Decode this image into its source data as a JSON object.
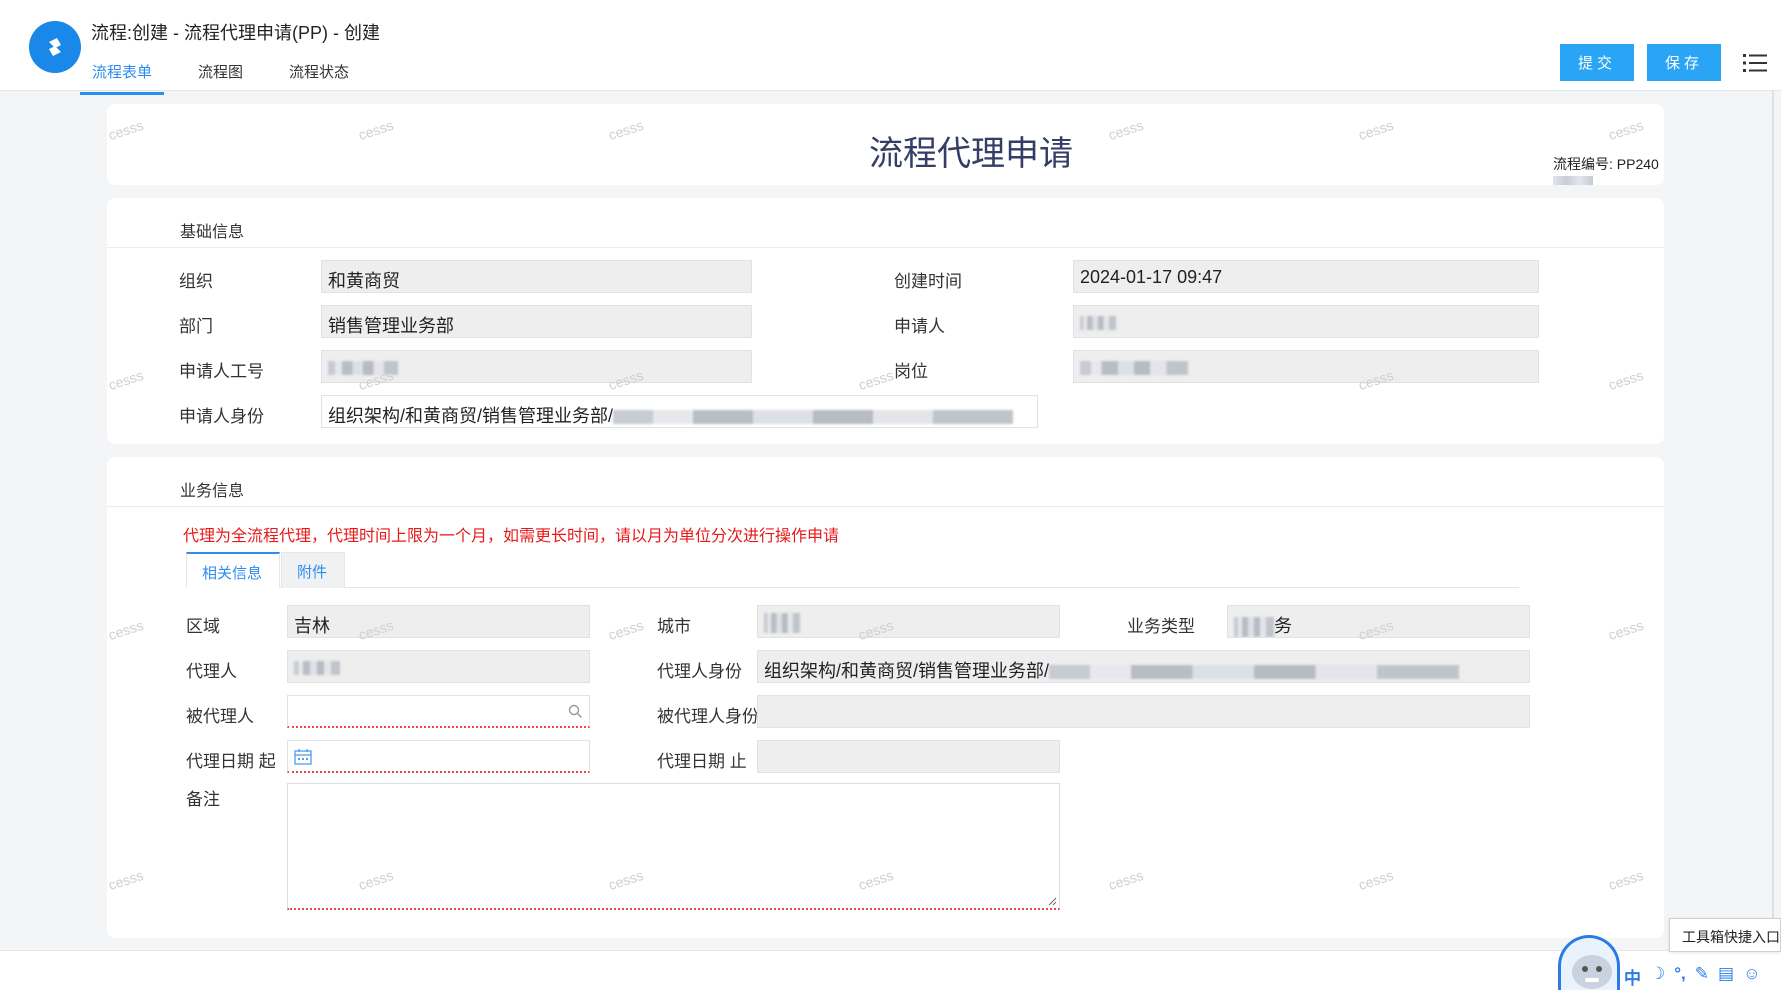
{
  "header": {
    "title": "流程:创建 - 流程代理申请(PP) - 创建",
    "tabs": [
      "流程表单",
      "流程图",
      "流程状态"
    ],
    "submit_label": "提交",
    "save_label": "保存"
  },
  "form": {
    "title": "流程代理申请",
    "flow_no_label": "流程编号:",
    "flow_no_value": "PP240"
  },
  "basic": {
    "section_title": "基础信息",
    "org_label": "组织",
    "org_value": "和黄商贸",
    "created_label": "创建时间",
    "created_value": "2024-01-17 09:47",
    "dept_label": "部门",
    "dept_value": "销售管理业务部",
    "applicant_label": "申请人",
    "emp_no_label": "申请人工号",
    "post_label": "岗位",
    "identity_label": "申请人身份",
    "identity_value": "组织架构/和黄商贸/销售管理业务部/"
  },
  "business": {
    "section_title": "业务信息",
    "notice": "代理为全流程代理，代理时间上限为一个月，如需更长时间，请以月为单位分次进行操作申请",
    "subtabs": [
      "相关信息",
      "附件"
    ],
    "region_label": "区域",
    "region_value": "吉林",
    "city_label": "城市",
    "biz_type_label": "业务类型",
    "biz_type_value": "务",
    "agent_label": "代理人",
    "agent_identity_label": "代理人身份",
    "agent_identity_value": "组织架构/和黄商贸/销售管理业务部/",
    "principal_label": "被代理人",
    "principal_identity_label": "被代理人身份",
    "date_start_label": "代理日期 起",
    "date_end_label": "代理日期 止",
    "remark_label": "备注"
  },
  "watermark": "cesss",
  "widgets": {
    "toolbox_label": "工具箱快捷入口",
    "ime": [
      "中",
      "☽",
      "°,",
      "✎",
      "▤",
      "☺"
    ]
  },
  "colors": {
    "accent": "#2d8cf0",
    "button": "#2aa4f4",
    "warning": "#e8191a"
  }
}
